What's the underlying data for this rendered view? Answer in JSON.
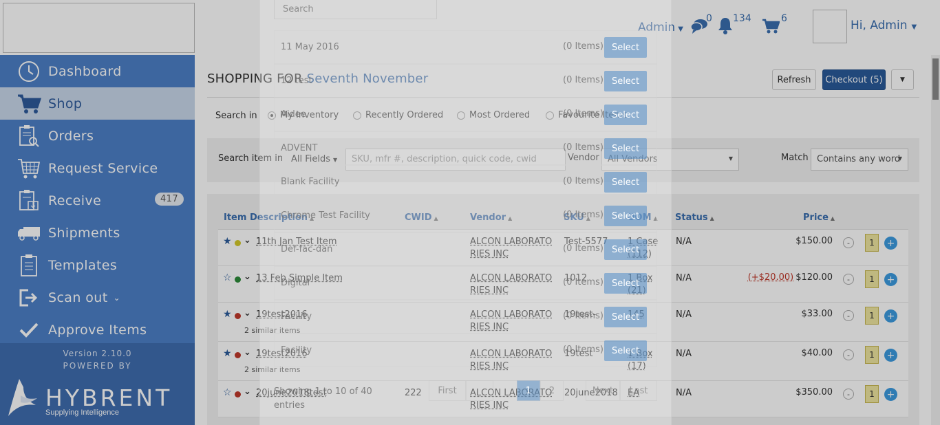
{
  "header": {
    "admin_menu": "Admin",
    "messages_count": "0",
    "notifications_count": "134",
    "cart_count": "6",
    "greeting": "Hi, Admin"
  },
  "sidebar": {
    "items": [
      {
        "label": "Dashboard",
        "icon": "clock-icon"
      },
      {
        "label": "Shop",
        "icon": "cart-icon"
      },
      {
        "label": "Orders",
        "icon": "clipboard-search-icon"
      },
      {
        "label": "Request Service",
        "icon": "cart-grid-icon"
      },
      {
        "label": "Receive",
        "icon": "clipboard-download-icon",
        "badge": "417"
      },
      {
        "label": "Shipments",
        "icon": "truck-icon"
      },
      {
        "label": "Templates",
        "icon": "clipboard-list-icon"
      },
      {
        "label": "Scan out",
        "icon": "sign-out-icon"
      },
      {
        "label": "Approve Items",
        "icon": "check-icon"
      }
    ],
    "version": "Version 2.10.0",
    "powered_by": "POWERED BY",
    "brand": "HYBRENT",
    "tagline": "Supplying Intelligence"
  },
  "main": {
    "title_prefix": "SHOPPING FOR",
    "title_name": "Seventh November",
    "refresh_label": "Refresh",
    "checkout_label": "Checkout (5)",
    "search_in_label": "Search in",
    "radios": [
      "My Inventory",
      "Recently Ordered",
      "Most Ordered",
      "Favourite Items"
    ],
    "filter": {
      "search_item_label": "Search item in",
      "fields_value": "All Fields",
      "search_placeholder": "SKU, mfr #, description, quick code, cwid",
      "vendor_label": "Vendor",
      "vendor_value": "All Vendors",
      "match_label": "Match",
      "match_value": "Contains any word"
    },
    "columns": [
      "Item Description",
      "CWID",
      "Vendor",
      "SKU",
      "UOM",
      "Status",
      "Price"
    ],
    "rows": [
      {
        "desc": "11th Jan Test Item",
        "similar": "",
        "cwid": "",
        "vendor1": "ALCON LABORATO",
        "vendor2": "RIES INC",
        "sku": "Test-5577",
        "uom1": "1 Case",
        "uom2": "(112)",
        "status": "N/A",
        "price_diff": "",
        "price": "$150.00",
        "qty": "1",
        "flag": "#d4c82a",
        "starred": true
      },
      {
        "desc": "13 Feb Simple Item",
        "similar": "",
        "cwid": "",
        "vendor1": "ALCON LABORATO",
        "vendor2": "RIES INC",
        "sku": "1012",
        "uom1": "1 Box",
        "uom2": "(21)",
        "status": "N/A",
        "price_diff": "(+$20.00)",
        "price": "$120.00",
        "qty": "1",
        "flag": "#2e8b3a",
        "starred": false
      },
      {
        "desc": "19test2016",
        "similar": "2 similar items",
        "cwid": "",
        "vendor1": "ALCON LABORATO",
        "vendor2": "RIES INC",
        "sku": "19test-",
        "uom1": "145",
        "uom2": "",
        "status": "N/A",
        "price_diff": "",
        "price": "$33.00",
        "qty": "1",
        "flag": "#c0392b",
        "starred": true
      },
      {
        "desc": "19test2016",
        "similar": "2 similar items",
        "cwid": "",
        "vendor1": "ALCON LABORATO",
        "vendor2": "RIES INC",
        "sku": "19test",
        "uom1": "1 Box",
        "uom2": "(17)",
        "status": "N/A",
        "price_diff": "",
        "price": "$40.00",
        "qty": "1",
        "flag": "#c0392b",
        "starred": true
      },
      {
        "desc": "20june2018test",
        "similar": "",
        "cwid": "222",
        "vendor1": "ALCON LABORATO",
        "vendor2": "RIES INC",
        "sku": "20june2018",
        "uom1": "EA",
        "uom2": "",
        "status": "N/A",
        "price_diff": "",
        "price": "$350.00",
        "qty": "1",
        "flag": "#c0392b",
        "starred": false
      }
    ]
  },
  "modal": {
    "search_placeholder": "Search",
    "facilities": [
      {
        "name": "11 May 2016",
        "count": "(0 Items)",
        "button": "Select"
      },
      {
        "name": "12 test",
        "count": "(0 Items)",
        "button": "Select"
      },
      {
        "name": "Aidee",
        "count": "(0 Items)",
        "button": "Select"
      },
      {
        "name": "ADVENT",
        "count": "(0 Items)",
        "button": "Select"
      },
      {
        "name": "Blank Facility",
        "count": "(0 Items)",
        "button": "Select"
      },
      {
        "name": "Chrome Test Facility",
        "count": "(0 Items)",
        "button": "Select"
      },
      {
        "name": "Def-fac-dan",
        "count": "(0 Items)",
        "button": "Select"
      },
      {
        "name": "Digital",
        "count": "(0 Items)",
        "button": "Select"
      },
      {
        "name": "Facility",
        "count": "(0 Items)",
        "button": "Select"
      },
      {
        "name": "Facility",
        "count": "(0 Items)",
        "button": "Select"
      }
    ],
    "footer_line1": "Showing 1 to 10 of 40",
    "footer_line2": "entries",
    "pager": {
      "first": "First",
      "page1": "1",
      "page2": "2",
      "next": "Next",
      "last": "Last"
    }
  }
}
